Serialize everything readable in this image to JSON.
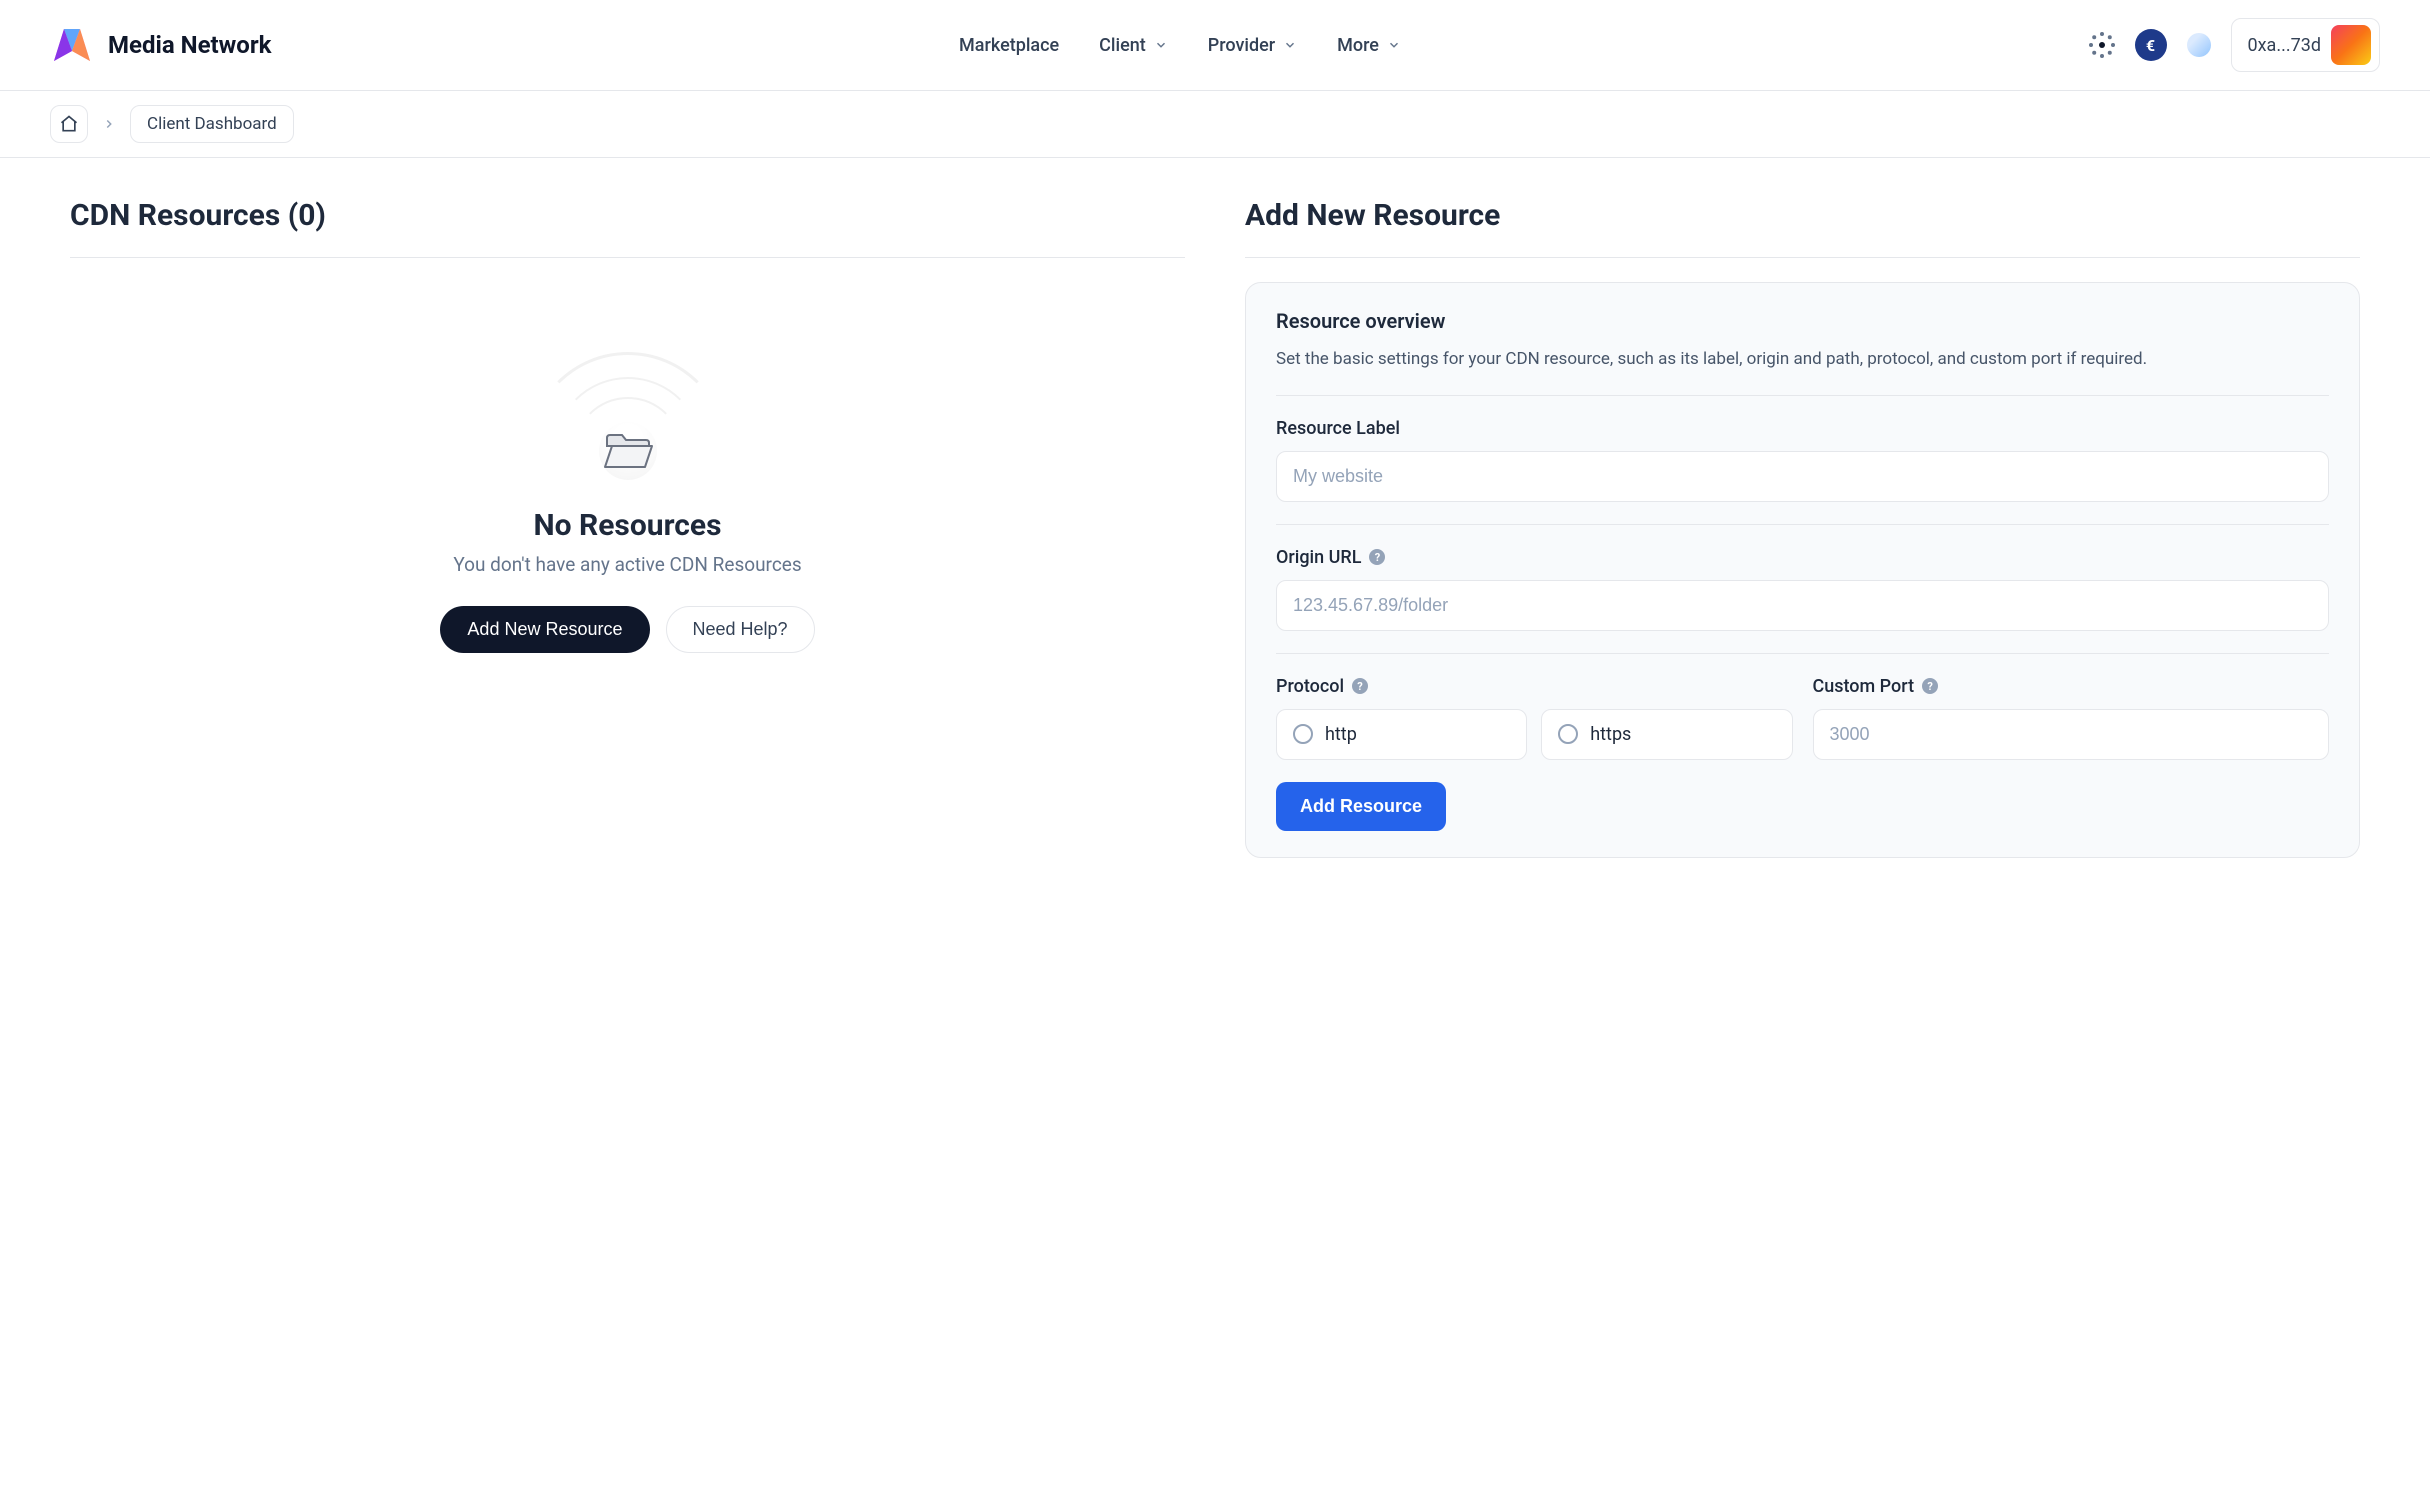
{
  "brand": "Media Network",
  "nav": {
    "marketplace": "Marketplace",
    "client": "Client",
    "provider": "Provider",
    "more": "More"
  },
  "header": {
    "currency_symbol": "€",
    "wallet_display": "0xa...73d"
  },
  "breadcrumb": {
    "current": "Client Dashboard"
  },
  "resources": {
    "title": "CDN Resources (0)",
    "empty_title": "No Resources",
    "empty_subtitle": "You don't have any active CDN Resources",
    "add_button": "Add New Resource",
    "help_button": "Need Help?"
  },
  "form": {
    "section_title": "Add New Resource",
    "panel_title": "Resource overview",
    "panel_desc": "Set the basic settings for your CDN resource, such as its label, origin and path, protocol, and custom port if required.",
    "label_field": "Resource Label",
    "label_placeholder": "My website",
    "origin_field": "Origin URL",
    "origin_placeholder": "123.45.67.89/folder",
    "protocol_field": "Protocol",
    "protocol_options": {
      "http": "http",
      "https": "https"
    },
    "port_field": "Custom Port",
    "port_placeholder": "3000",
    "submit": "Add Resource"
  },
  "colors": {
    "primary_blue": "#2563eb",
    "dark": "#0f172a",
    "border": "#e5e7eb",
    "muted": "#64748b"
  }
}
